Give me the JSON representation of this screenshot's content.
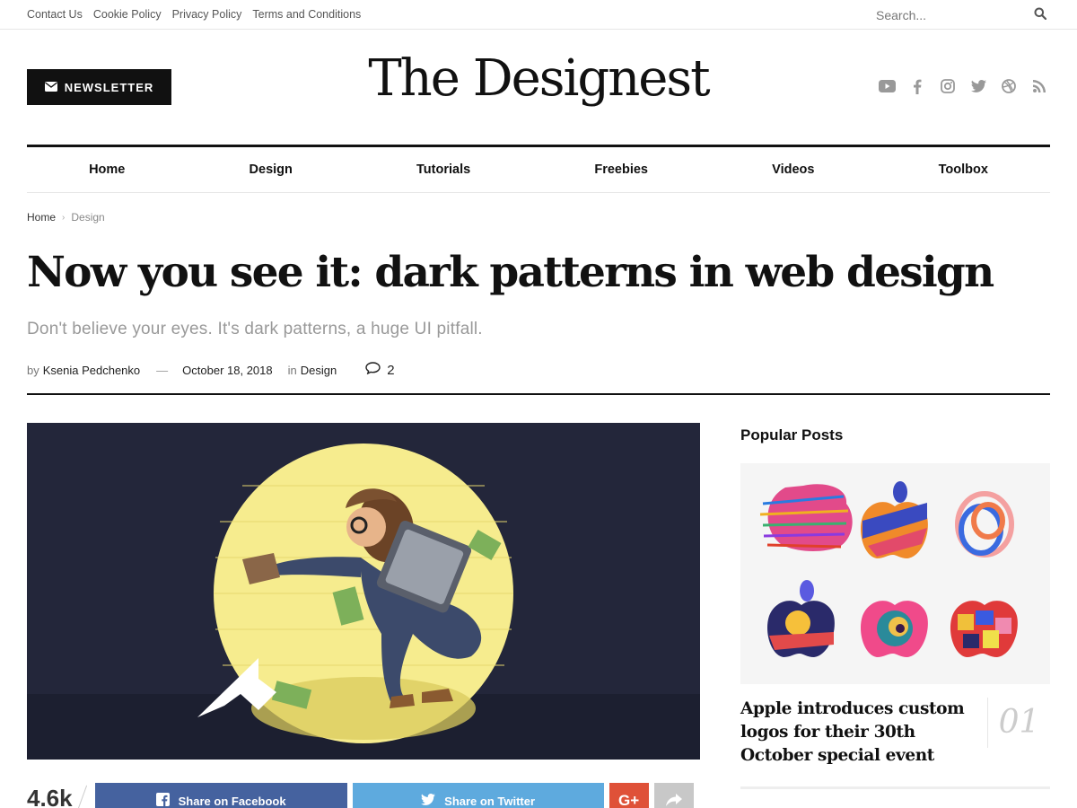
{
  "topbar": {
    "links": [
      "Contact Us",
      "Cookie Policy",
      "Privacy Policy",
      "Terms and Conditions"
    ],
    "search_placeholder": "Search..."
  },
  "header": {
    "newsletter_label": "NEWSLETTER",
    "logo": "The Designest",
    "socials": [
      "youtube-icon",
      "facebook-icon",
      "instagram-icon",
      "twitter-icon",
      "dribbble-icon",
      "rss-icon"
    ]
  },
  "nav": [
    "Home",
    "Design",
    "Tutorials",
    "Freebies",
    "Videos",
    "Toolbox"
  ],
  "breadcrumb": {
    "home": "Home",
    "current": "Design"
  },
  "article": {
    "title": "Now you see it: dark patterns in web design",
    "subtitle": "Don't believe your eyes. It's dark patterns, a huge UI pitfall.",
    "by": "by",
    "author": "Ksenia Pedchenko",
    "dash": "—",
    "date": "October 18, 2018",
    "in": "in",
    "category": "Design",
    "comments": "2"
  },
  "share": {
    "count": "4.6k",
    "facebook_label": "Share on Facebook",
    "twitter_label": "Share on Twitter",
    "gplus_label": "G+"
  },
  "sidebar": {
    "title": "Popular Posts",
    "post_title": "Apple introduces custom logos for their 30th October special event",
    "post_number": "01"
  },
  "colors": {
    "facebook": "#45629f",
    "twitter": "#5eaade",
    "gplus": "#df5138",
    "hero_bg": "#23263a",
    "spotlight": "#f6ec8e"
  }
}
